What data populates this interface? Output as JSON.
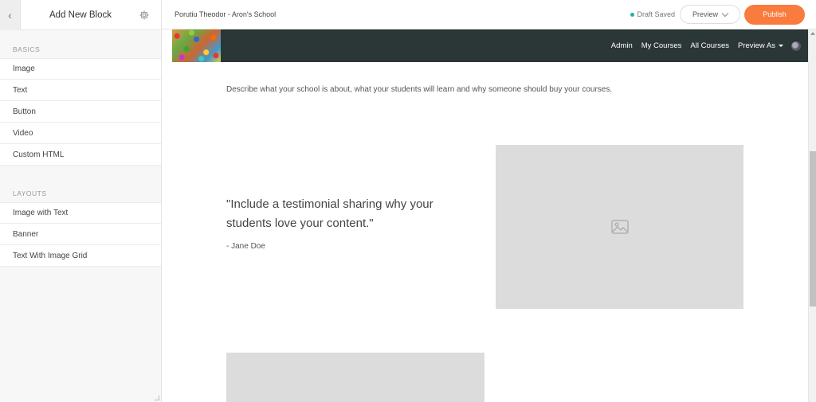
{
  "sidebar": {
    "title": "Add New Block",
    "sections": [
      {
        "label": "BASICS",
        "items": [
          "Image",
          "Text",
          "Button",
          "Video",
          "Custom HTML"
        ]
      },
      {
        "label": "LAYOUTS",
        "items": [
          "Image with Text",
          "Banner",
          "Text With Image Grid"
        ]
      }
    ]
  },
  "topbar": {
    "school_name": "Porutiu Theodor - Aron's School",
    "status": "Draft Saved",
    "preview_label": "Preview",
    "publish_label": "Publish"
  },
  "site_nav": {
    "links": [
      "Admin",
      "My Courses",
      "All Courses"
    ],
    "preview_as": "Preview As"
  },
  "content": {
    "intro": "Describe what your school is about, what your students will learn and why someone should buy your courses.",
    "quote": "\"Include a testimonial sharing why your students love your content.\"",
    "author": "- Jane Doe"
  },
  "colors": {
    "publish": "#f97b3d",
    "nav_bg": "#2b3636",
    "status_dot": "#23b2a0"
  }
}
